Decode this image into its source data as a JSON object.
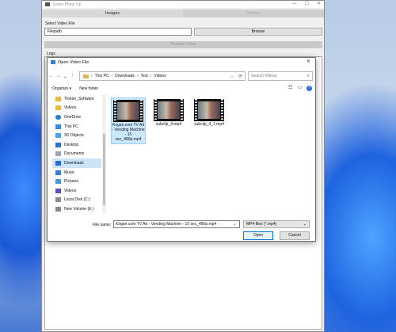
{
  "app": {
    "title": "Scene Photo Up",
    "controls": [
      "—",
      "☐",
      "✕"
    ],
    "tabs": [
      {
        "label": "Images",
        "active": true
      },
      {
        "label": "Videos",
        "active": false
      }
    ],
    "select_label": "Select Video File",
    "file_placeholder": "Filepath",
    "browse_label": "Browse",
    "process_label": "Process Video",
    "logs_label": "Logs"
  },
  "dialog": {
    "title": "Open Video File",
    "close": "✕",
    "nav": [
      "←",
      "→",
      "⌄",
      "↑"
    ],
    "breadcrumb": [
      "This PC",
      "Downloads",
      "Test",
      "Videos"
    ],
    "breadcrumb_separator": "›",
    "search_placeholder": "Search Videos",
    "organize_label": "Organize ▾",
    "new_folder_label": "New folder",
    "sidebar": [
      {
        "label": "Tkinter_Software",
        "icon": "folder-icon",
        "color": "#e8b64a"
      },
      {
        "label": "Videos",
        "icon": "folder-icon",
        "color": "#e8b64a"
      },
      {
        "label": "OneDrive",
        "icon": "cloud-icon",
        "color": "#2a7bd5"
      },
      {
        "label": "This PC",
        "icon": "computer-icon",
        "color": "#3a8ad8"
      },
      {
        "label": "3D Objects",
        "icon": "cube-icon",
        "color": "#4fa3e0"
      },
      {
        "label": "Desktop",
        "icon": "desktop-icon",
        "color": "#2f6fc8"
      },
      {
        "label": "Documents",
        "icon": "documents-icon",
        "color": "#9aa5b5"
      },
      {
        "label": "Downloads",
        "icon": "download-icon",
        "color": "#2a6ad6",
        "selected": true
      },
      {
        "label": "Music",
        "icon": "music-icon",
        "color": "#3a7bd5"
      },
      {
        "label": "Pictures",
        "icon": "pictures-icon",
        "color": "#4f95d8"
      },
      {
        "label": "Videos",
        "icon": "videos-icon",
        "color": "#5a4fb8"
      },
      {
        "label": "Local Disk (C:)",
        "icon": "drive-icon",
        "color": "#8a8a8a"
      },
      {
        "label": "New Volume (E:)",
        "icon": "drive-icon",
        "color": "#8a8a8a"
      }
    ],
    "files": [
      {
        "name": "Kogan.com TV Ad - Vending Machine - 15 sec_480p.mp4",
        "selected": true
      },
      {
        "name": "subclip_4.mp4",
        "selected": false
      },
      {
        "name": "subclip_4_1.mp4",
        "selected": false
      }
    ],
    "file_name_label": "File name:",
    "file_name_value": "Kogan.com TV Ad - Vending Machine - 15 sec_480p.mp4",
    "file_type": "MP4 files (*.mp4)",
    "open_label": "Open",
    "cancel_label": "Cancel"
  }
}
